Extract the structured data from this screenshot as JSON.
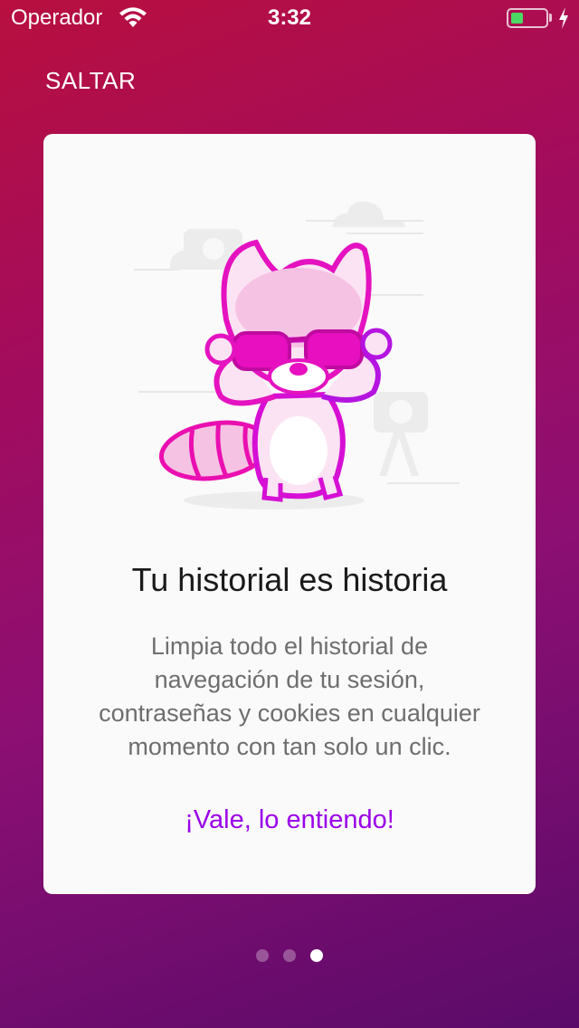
{
  "status_bar": {
    "carrier": "Operador",
    "time": "3:32",
    "battery_level": 0.35,
    "battery_color": "#4cd964"
  },
  "skip_label": "SALTAR",
  "card": {
    "title": "Tu historial es historia",
    "body": "Limpia todo el historial de navegación de tu sesión, contraseñas y cookies en cualquier momento con tan solo un clic.",
    "link": "¡Vale, lo entiendo!",
    "link_color": "#9b00e8",
    "illustration_icon": "raccoon-with-sunglasses"
  },
  "pager": {
    "count": 3,
    "active": 2
  }
}
